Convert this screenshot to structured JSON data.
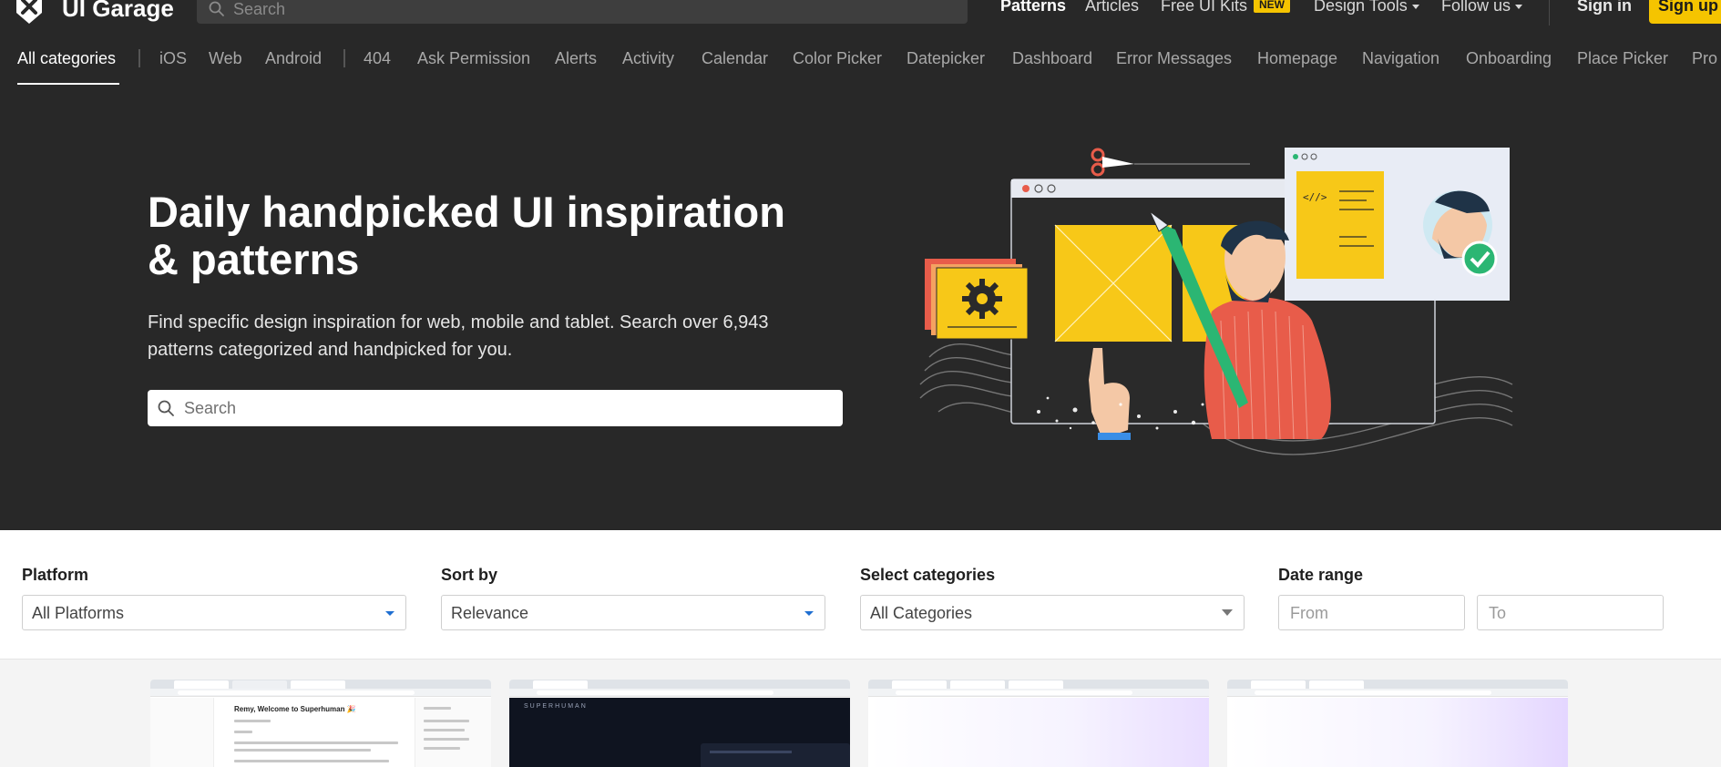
{
  "topbar": {
    "brand": "UI Garage",
    "search_placeholder": "Search",
    "nav": {
      "patterns": "Patterns",
      "articles": "Articles",
      "free_ui_kits": "Free UI Kits",
      "new_badge": "NEW",
      "design_tools": "Design Tools",
      "follow_us": "Follow us"
    },
    "sign_in": "Sign in",
    "sign_up": "Sign up"
  },
  "categories": {
    "all": "All categories",
    "platforms": [
      "iOS",
      "Web",
      "Android"
    ],
    "items": [
      "404",
      "Ask Permission",
      "Alerts",
      "Activity",
      "Calendar",
      "Color Picker",
      "Datepicker",
      "Dashboard",
      "Error Messages",
      "Homepage",
      "Navigation",
      "Onboarding",
      "Place Picker",
      "Pro"
    ]
  },
  "hero": {
    "title_line1": "Daily handpicked UI inspiration",
    "title_line2": "& patterns",
    "subtitle_line1": "Find specific design inspiration for web, mobile and tablet. Search over 6,943",
    "subtitle_line2": "patterns categorized and handpicked for you.",
    "search_placeholder": "Search"
  },
  "filters": {
    "platform": {
      "label": "Platform",
      "value": "All Platforms"
    },
    "sort_by": {
      "label": "Sort by",
      "value": "Relevance"
    },
    "categories": {
      "label": "Select categories",
      "value": "All Categories"
    },
    "date_range": {
      "label": "Date range",
      "from_placeholder": "From",
      "to_placeholder": "To"
    }
  },
  "thumbnails": {
    "t1_heading": "Remy, Welcome to Superhuman 🎉",
    "t2_logo": "SUPERHUMAN"
  },
  "colors": {
    "dark_bg": "#282828",
    "accent_yellow": "#f5c400",
    "select_arrow": "#1f6fd1"
  }
}
